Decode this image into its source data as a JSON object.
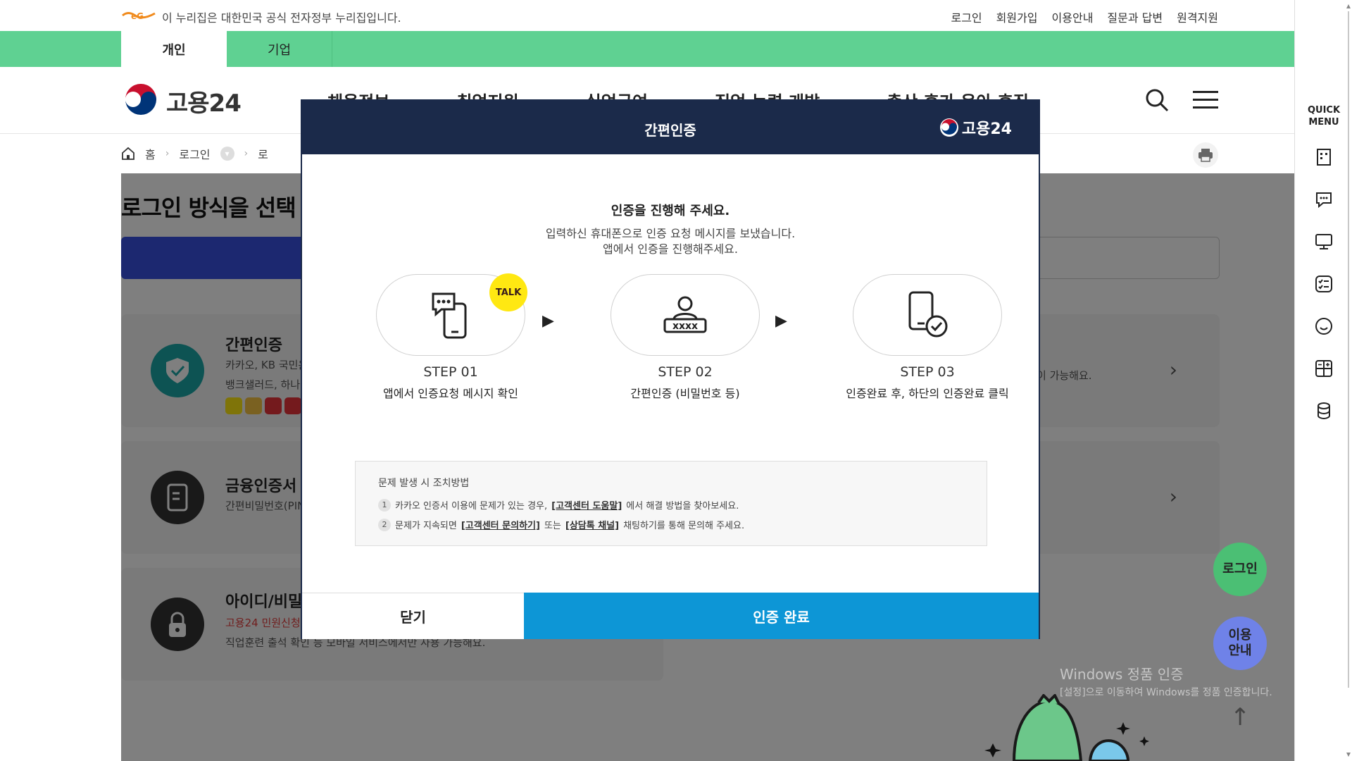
{
  "gov_banner": {
    "text": "이 누리집은 대한민국 공식 전자정부 누리집입니다."
  },
  "util_links": [
    "로그인",
    "회원가입",
    "이용안내",
    "질문과 답변",
    "원격지원"
  ],
  "tabs": [
    {
      "label": "개인"
    },
    {
      "label": "기업"
    }
  ],
  "header": {
    "brand": "고용24",
    "gnb": [
      "채용정보",
      "취업지원",
      "실업급여",
      "직업 능력 개발",
      "출산 휴가 육아 휴직"
    ]
  },
  "breadcrumb": {
    "home": "홈",
    "login": "로그인",
    "third": "로"
  },
  "page": {
    "title": "로그인 방식을 선택",
    "cards": [
      {
        "title": "간편인증",
        "desc1": "카카오, KB 국민은",
        "desc2": "뱅크샐러드, 하나",
        "right_text": "이 가능해요."
      },
      {
        "title": "금융인증서",
        "desc1": "간편비밀번호(PIN"
      },
      {
        "title": "아이디/비밀",
        "notice": "고용24 민원신청",
        "desc1": "직업훈련 출석 확인 등 모바일 서비스에서만 사용 가능해요."
      }
    ]
  },
  "quick_menu": {
    "title_line1": "QUICK",
    "title_line2": "MENU"
  },
  "fabs": {
    "login": "로그인",
    "guide_line1": "이용",
    "guide_line2": "안내"
  },
  "watermark": {
    "line1": "Windows 정품 인증",
    "line2": "[설정]으로 이동하여 Windows를 정품 인증합니다."
  },
  "modal": {
    "title": "간편인증",
    "brand": "고용24",
    "lead": "인증을 진행해 주세요.",
    "sub1": "입력하신 휴대폰으로 인증 요청 메시지를 보냈습니다.",
    "sub2": "앱에서 인증을 진행해주세요.",
    "talk_badge": "TALK",
    "steps": [
      {
        "num": "STEP 01",
        "desc": "앱에서 인증요청 메시지 확인"
      },
      {
        "num": "STEP 02",
        "desc": "간편인증 (비밀번호 등)"
      },
      {
        "num": "STEP 03",
        "desc": "인증완료 후, 하단의 인증완료 클릭"
      }
    ],
    "arrow": "▶",
    "help": {
      "title": "문제 발생 시 조치방법",
      "line1_num": "1",
      "line1_pre": "카카오 인증서 이용에 문제가 있는 경우,",
      "line1_link": "[고객센터 도움말]",
      "line1_post": "에서 해결 방법을 찾아보세요.",
      "line2_num": "2",
      "line2_pre": "문제가 지속되면",
      "line2_link1": "[고객센터 문의하기]",
      "line2_mid": "또는",
      "line2_link2": "[상담톡 채널]",
      "line2_post": "채팅하기를 통해 문의해 주세요."
    },
    "close_label": "닫기",
    "done_label": "인증 완료"
  },
  "colors": {
    "tab_green": "#5fd192",
    "modal_navy": "#1b2a4a",
    "done_blue": "#0d96d6",
    "talk_yellow": "#ffe812"
  }
}
